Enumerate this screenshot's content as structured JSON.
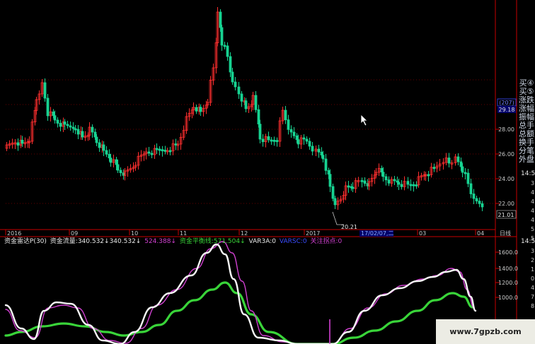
{
  "price_panel": {
    "y_ticks": [
      "28.00",
      "26.00",
      "24.00",
      "22.00"
    ],
    "current_badge": "(207)",
    "current_value": "29.18",
    "last_price_label": "21.01",
    "low_label": "20.21",
    "x_ticks": [
      "2016",
      "09",
      "10",
      "11",
      "12",
      "2017",
      "03",
      "04"
    ],
    "crosshair_date": "17/02/07,二",
    "period_label": "日线",
    "time_label": "14:5"
  },
  "right_panel": {
    "labels": [
      "买④",
      "买⑤",
      "涨跌",
      "涨幅",
      "振幅",
      "总手",
      "总额",
      "换手",
      "分笔",
      "外盘"
    ],
    "right_edge_top": [
      "14:5",
      "3",
      "4",
      "4",
      "4",
      "4",
      "5",
      "5"
    ]
  },
  "indicator_panel": {
    "name": "资金雷达P(30)",
    "items": [
      {
        "text": "资金流量:340.532↓340.532↓",
        "color": "#e8e8e8"
      },
      {
        "text": "524.388↓",
        "color": "#d040d0"
      },
      {
        "text": "资金平衡线:571.504↓",
        "color": "#39d439"
      },
      {
        "text": "VAR3A:0",
        "color": "#e8e8e8"
      },
      {
        "text": "VARSC:0",
        "color": "#3a4dff"
      },
      {
        "text": "关注拐点:0",
        "color": "#d040d0"
      }
    ],
    "y_ticks": [
      "1600.0",
      "1400.0",
      "1200.0",
      "1000.0"
    ],
    "time_label": "14:5",
    "right_edge": [
      "3",
      "2",
      "1",
      "0",
      "4",
      "7",
      "8"
    ]
  },
  "watermark": "www.7gpzb.com",
  "colors": {
    "up": "#ff2f2f",
    "down": "#17d391",
    "flow": "#f7f7f7",
    "flow2": "#d040d0",
    "balance": "#39d439",
    "grid": "#c80000",
    "axis": "#c80000"
  },
  "chart_data": {
    "type": "candlestick",
    "x": [
      "2016",
      "09",
      "10",
      "11",
      "12",
      "2017",
      "03",
      "04"
    ],
    "ylim": [
      20.0,
      29.5
    ],
    "low_marker": 20.21,
    "last": 21.01,
    "indicator": {
      "series": [
        {
          "name": "资金流量",
          "color": "#f7f7f7"
        },
        {
          "name": "524.388",
          "color": "#d040d0"
        },
        {
          "name": "资金平衡线",
          "color": "#39d439"
        }
      ],
      "ylim": [
        800,
        1700
      ]
    }
  }
}
